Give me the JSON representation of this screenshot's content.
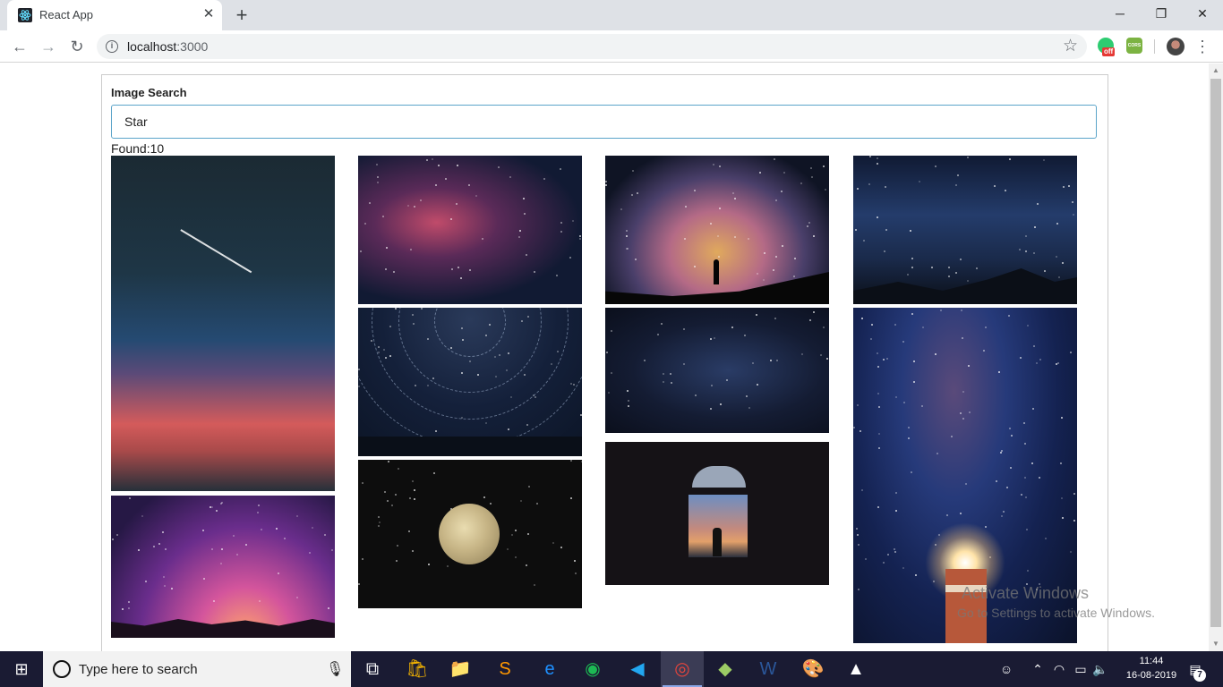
{
  "browser": {
    "tab_title": "React App",
    "tab_close": "✕",
    "new_tab": "+",
    "url_host": "localhost",
    "url_port": ":3000",
    "window_controls": {
      "minimize": "─",
      "maximize": "❐",
      "close": "✕"
    },
    "extensions": {
      "grammarly_badge": "off",
      "cors_label": "CORS"
    }
  },
  "page": {
    "label": "Image Search",
    "search_value": "Star",
    "found_text": "Found:10",
    "images": [
      {
        "name": "shooting-star-sunset"
      },
      {
        "name": "purple-milky-way-hills"
      },
      {
        "name": "pink-nebula"
      },
      {
        "name": "star-trails"
      },
      {
        "name": "full-moon"
      },
      {
        "name": "milky-way-silhouette"
      },
      {
        "name": "blue-starfield"
      },
      {
        "name": "window-view"
      },
      {
        "name": "mountain-milky-way"
      },
      {
        "name": "lighthouse-milky-way"
      }
    ]
  },
  "watermark": {
    "line1": "Activate Windows",
    "line2": "Go to Settings to activate Windows."
  },
  "taskbar": {
    "search_placeholder": "Type here to search",
    "time": "11:44",
    "date": "16-08-2019",
    "notification_count": "7"
  }
}
